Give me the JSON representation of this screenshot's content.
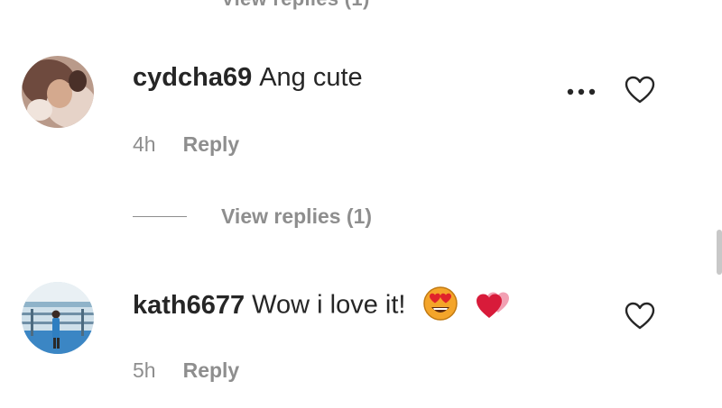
{
  "previous": {
    "clipped_text": "View replies (1)"
  },
  "comments": [
    {
      "username": "cydcha69",
      "text": "Ang cute",
      "time": "4h",
      "reply_label": "Reply",
      "avatar_icon": "user-avatar",
      "view_replies_label": "View replies (1)"
    },
    {
      "username": "kath6677",
      "text": "Wow i love it!",
      "emojis": [
        "heart-eyes-emoji",
        "two-hearts-emoji"
      ],
      "time": "5h",
      "reply_label": "Reply",
      "avatar_icon": "user-avatar"
    }
  ],
  "colors": {
    "text": "#262626",
    "secondary": "#8e8e8e",
    "background": "#ffffff"
  }
}
